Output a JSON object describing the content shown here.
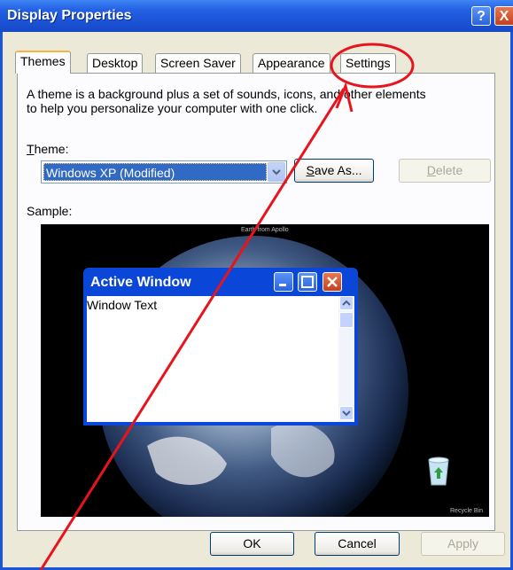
{
  "window": {
    "title": "Display Properties",
    "help_label": "?",
    "close_label": "X"
  },
  "tabs": [
    {
      "label": "Themes",
      "active": true
    },
    {
      "label": "Desktop",
      "active": false
    },
    {
      "label": "Screen Saver",
      "active": false
    },
    {
      "label": "Appearance",
      "active": false
    },
    {
      "label": "Settings",
      "active": false
    }
  ],
  "themes_tab": {
    "description_line1": "A theme is a background plus a set of sounds, icons, and other elements",
    "description_line2": "to help you personalize your computer with one click.",
    "theme_label_mnemonic": "T",
    "theme_label_rest": "heme:",
    "theme_value": "Windows XP (Modified)",
    "save_as_mnemonic": "S",
    "save_as_rest": "ave As...",
    "delete_mnemonic": "D",
    "delete_rest": "elete",
    "sample_label": "Sample:"
  },
  "sample": {
    "caption": "Earth from Apollo",
    "window_title": "Active Window",
    "window_text": "Window Text",
    "recycle_label": "Recycle Bin"
  },
  "footer": {
    "ok_label": "OK",
    "cancel_label": "Cancel",
    "apply_label": "Apply"
  },
  "annotation": {
    "color": "#e8141c",
    "target": "Settings"
  }
}
